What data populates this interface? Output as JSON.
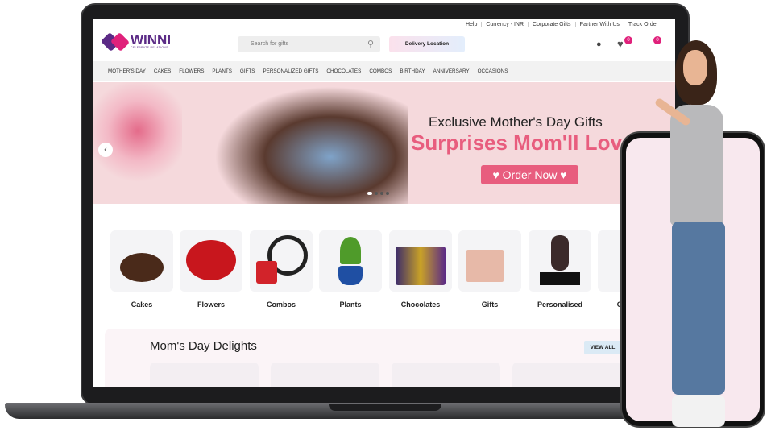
{
  "top_links": [
    "Help",
    "Currency - INR",
    "Corporate Gifts",
    "Partner With Us",
    "Track Order"
  ],
  "logo": {
    "name": "WINNI",
    "tagline": "CELEBRATE RELATIONS"
  },
  "search": {
    "placeholder": "Search for gifts"
  },
  "delivery_label": "Delivery Location",
  "wishlist_count": "0",
  "cart_count": "0",
  "nav": [
    "MOTHER'S DAY",
    "CAKES",
    "FLOWERS",
    "PLANTS",
    "GIFTS",
    "PERSONALIZED GIFTS",
    "CHOCOLATES",
    "COMBOS",
    "BIRTHDAY",
    "ANNIVERSARY",
    "OCCASIONS"
  ],
  "banner": {
    "line1": "Exclusive Mother's Day Gifts",
    "line2": "Surprises Mom'll Love",
    "cta": "♥ Order Now ♥"
  },
  "categories": [
    "Cakes",
    "Flowers",
    "Combos",
    "Plants",
    "Chocolates",
    "Gifts",
    "Personalised",
    "Crystal"
  ],
  "section": {
    "title": "Mom's Day Delights",
    "view_all": "VIEW ALL"
  },
  "colors": {
    "brand": "#5b2a86",
    "accent": "#e0217b",
    "banner_pink": "#e85d7e"
  }
}
